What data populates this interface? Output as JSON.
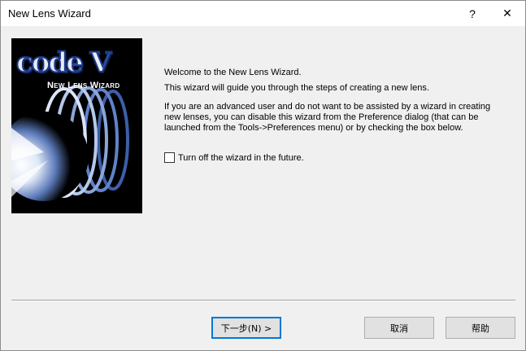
{
  "window": {
    "title": "New Lens Wizard",
    "help_glyph": "?",
    "close_glyph": "✕"
  },
  "banner": {
    "logo_text": "code V",
    "subtitle": "New Lens Wizard"
  },
  "content": {
    "welcome": "Welcome to the New Lens Wizard.",
    "guide": "This wizard will guide you through the steps of creating a new lens.",
    "advanced": "If you are an advanced user and do not want to be assisted by a wizard in creating new lenses, you can disable this wizard from the Preference dialog (that can be launched from the Tools->Preferences menu) or by checking the box below."
  },
  "checkbox": {
    "label": "Turn off the wizard in the future.",
    "checked": false
  },
  "buttons": {
    "next": "下一步(N) >",
    "cancel": "取消",
    "help": "帮助"
  },
  "colors": {
    "accent": "#0078d7",
    "dialog_bg": "#f0f0f0"
  }
}
